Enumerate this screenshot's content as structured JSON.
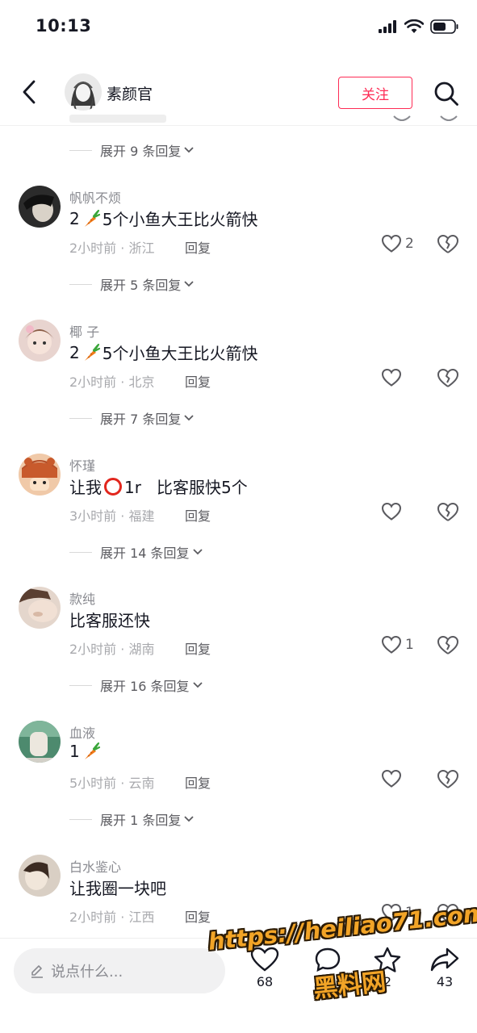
{
  "status_bar": {
    "time": "10:13"
  },
  "header": {
    "username": "素颜官",
    "follow_label": "关注"
  },
  "top_expand": {
    "label": "展开 9 条回复"
  },
  "comments": [
    {
      "user": "帆帆不烦",
      "text_before": "2",
      "emoji": "carrot",
      "text_after": "5个小鱼大王比火箭快",
      "meta": "2小时前 · 浙江",
      "reply": "回复",
      "likes": "2",
      "expand": "展开 5 条回复"
    },
    {
      "user": "椰 子",
      "text_before": "2",
      "emoji": "carrot",
      "text_after": "5个小鱼大王比火箭快",
      "meta": "2小时前 · 北京",
      "reply": "回复",
      "likes": "",
      "expand": "展开 7 条回复"
    },
    {
      "user": "怀瑾",
      "text_before": "让我",
      "emoji": "red-circle",
      "text_after": "1r   比客服快5个",
      "meta": "3小时前 · 福建",
      "reply": "回复",
      "likes": "",
      "expand": "展开 14 条回复"
    },
    {
      "user": "款纯",
      "text_before": "比客服还快",
      "emoji": "",
      "text_after": "",
      "meta": "2小时前 · 湖南",
      "reply": "回复",
      "likes": "1",
      "expand": "展开 16 条回复"
    },
    {
      "user": "血液",
      "text_before": "1",
      "emoji": "carrot",
      "text_after": "",
      "meta": "5小时前 · 云南",
      "reply": "回复",
      "likes": "",
      "expand": "展开 1 条回复"
    },
    {
      "user": "白水鉴心",
      "text_before": "让我圈一块吧",
      "emoji": "",
      "text_after": "",
      "meta": "2小时前 · 江西",
      "reply": "回复",
      "likes": "1",
      "expand": ""
    }
  ],
  "bottom_bar": {
    "placeholder": "说点什么...",
    "like_count": "68",
    "comment_count": "",
    "favorite_count": "2",
    "share_count": "43"
  },
  "watermark": {
    "url": "https://heiliao71.com",
    "site": "黑料网"
  },
  "colors": {
    "accent": "#fe2c55",
    "watermark": "#f2a427"
  }
}
